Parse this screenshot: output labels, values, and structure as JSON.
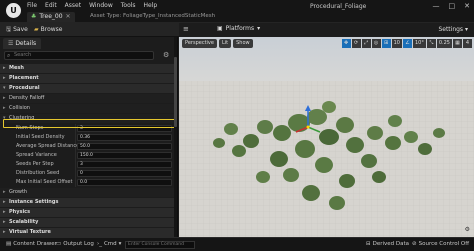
{
  "titlebar": {
    "logo_text": "U",
    "menu": [
      "File",
      "Edit",
      "Asset",
      "Window",
      "Tools",
      "Help"
    ],
    "document_tab": "Tree_00",
    "asset_type": "Asset Type: FoliageType_InstancedStaticMesh",
    "project_name": "Procedural_Foliage",
    "window_controls": [
      "—",
      "□",
      "✕"
    ]
  },
  "toolbar": {
    "save_label": "Save",
    "browse_label": "Browse"
  },
  "details": {
    "tab_label": "Details",
    "search_placeholder": "Search",
    "categories": {
      "mesh": "Mesh",
      "placement": "Placement",
      "procedural": "Procedural",
      "density_falloff": "Density Falloff",
      "collision": "Collision",
      "clustering": "Clustering",
      "growth": "Growth",
      "instance_settings": "Instance Settings",
      "physics": "Physics",
      "scalability": "Scalability",
      "virtual_texture": "Virtual Texture"
    },
    "properties": [
      {
        "name": "Num Steps",
        "value": "3"
      },
      {
        "name": "Initial Seed Density",
        "value": "0.36"
      },
      {
        "name": "Average Spread Distance",
        "value": "50.0"
      },
      {
        "name": "Spread Variance",
        "value": "150.0"
      },
      {
        "name": "Seeds Per Step",
        "value": "3"
      },
      {
        "name": "Distribution Seed",
        "value": "0"
      },
      {
        "name": "Max Initial Seed Offset",
        "value": "0.0"
      }
    ]
  },
  "viewport": {
    "tab_label": "Platforms",
    "settings_label": "Settings",
    "left_tools": [
      "Perspective",
      "Lit",
      "Show"
    ],
    "right_tools": [
      "✥",
      "⟳",
      "⤢",
      "◎",
      "⊞",
      "10",
      "∠",
      "10°",
      "⤡",
      "0.25",
      "▦",
      "4"
    ]
  },
  "statusbar": {
    "content_drawer": "Content Drawer",
    "output_log": "Output Log",
    "cmd": "Cmd",
    "cmd_placeholder": "Enter Console Command",
    "derived_data": "Derived Data",
    "source_control": "Source Control Off"
  }
}
